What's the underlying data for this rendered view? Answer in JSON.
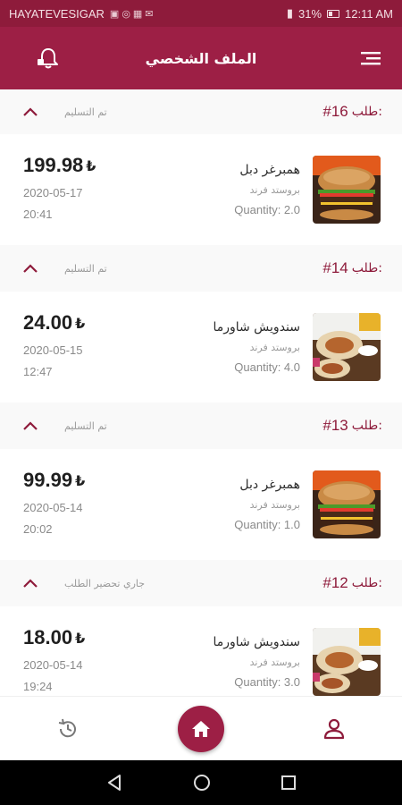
{
  "status_bar": {
    "carrier": "HAYATEVESIGAR",
    "battery": "31%",
    "time": "12:11 AM"
  },
  "app_bar": {
    "title": "الملف الشخصي",
    "icons": {
      "left": "bell-icon",
      "right": "menu-icon"
    }
  },
  "orders": [
    {
      "order_word": "طلب:",
      "order_number": "#16",
      "status": "تم التسليم",
      "item": {
        "name": "همبرغر دبل",
        "subtitle": "بروستد فرند",
        "quantity": "Quantity: 2.0",
        "price": "199.98",
        "currency": "₺",
        "date": "2020-05-17",
        "time": "20:41",
        "image": "burger"
      }
    },
    {
      "order_word": "طلب:",
      "order_number": "#14",
      "status": "تم التسليم",
      "item": {
        "name": "سندويش شاورما",
        "subtitle": "بروستد فرند",
        "quantity": "Quantity: 4.0",
        "price": "24.00",
        "currency": "₺",
        "date": "2020-05-15",
        "time": "12:47",
        "image": "shawarma"
      }
    },
    {
      "order_word": "طلب:",
      "order_number": "#13",
      "status": "تم التسليم",
      "item": {
        "name": "همبرغر دبل",
        "subtitle": "بروستد فرند",
        "quantity": "Quantity: 1.0",
        "price": "99.99",
        "currency": "₺",
        "date": "2020-05-14",
        "time": "20:02",
        "image": "burger"
      }
    },
    {
      "order_word": "طلب:",
      "order_number": "#12",
      "status": "جاري تحضير الطلب",
      "item": {
        "name": "سندويش شاورما",
        "subtitle": "بروستد فرند",
        "quantity": "Quantity: 3.0",
        "price": "18.00",
        "currency": "₺",
        "date": "2020-05-14",
        "time": "19:24",
        "image": "shawarma"
      }
    }
  ],
  "bottom_nav": {
    "items": [
      "history-icon",
      "home-icon",
      "profile-icon"
    ]
  },
  "colors": {
    "primary": "#9d1f45",
    "status_bar": "#8e1b3b",
    "accent_text": "#8e1b3b"
  }
}
